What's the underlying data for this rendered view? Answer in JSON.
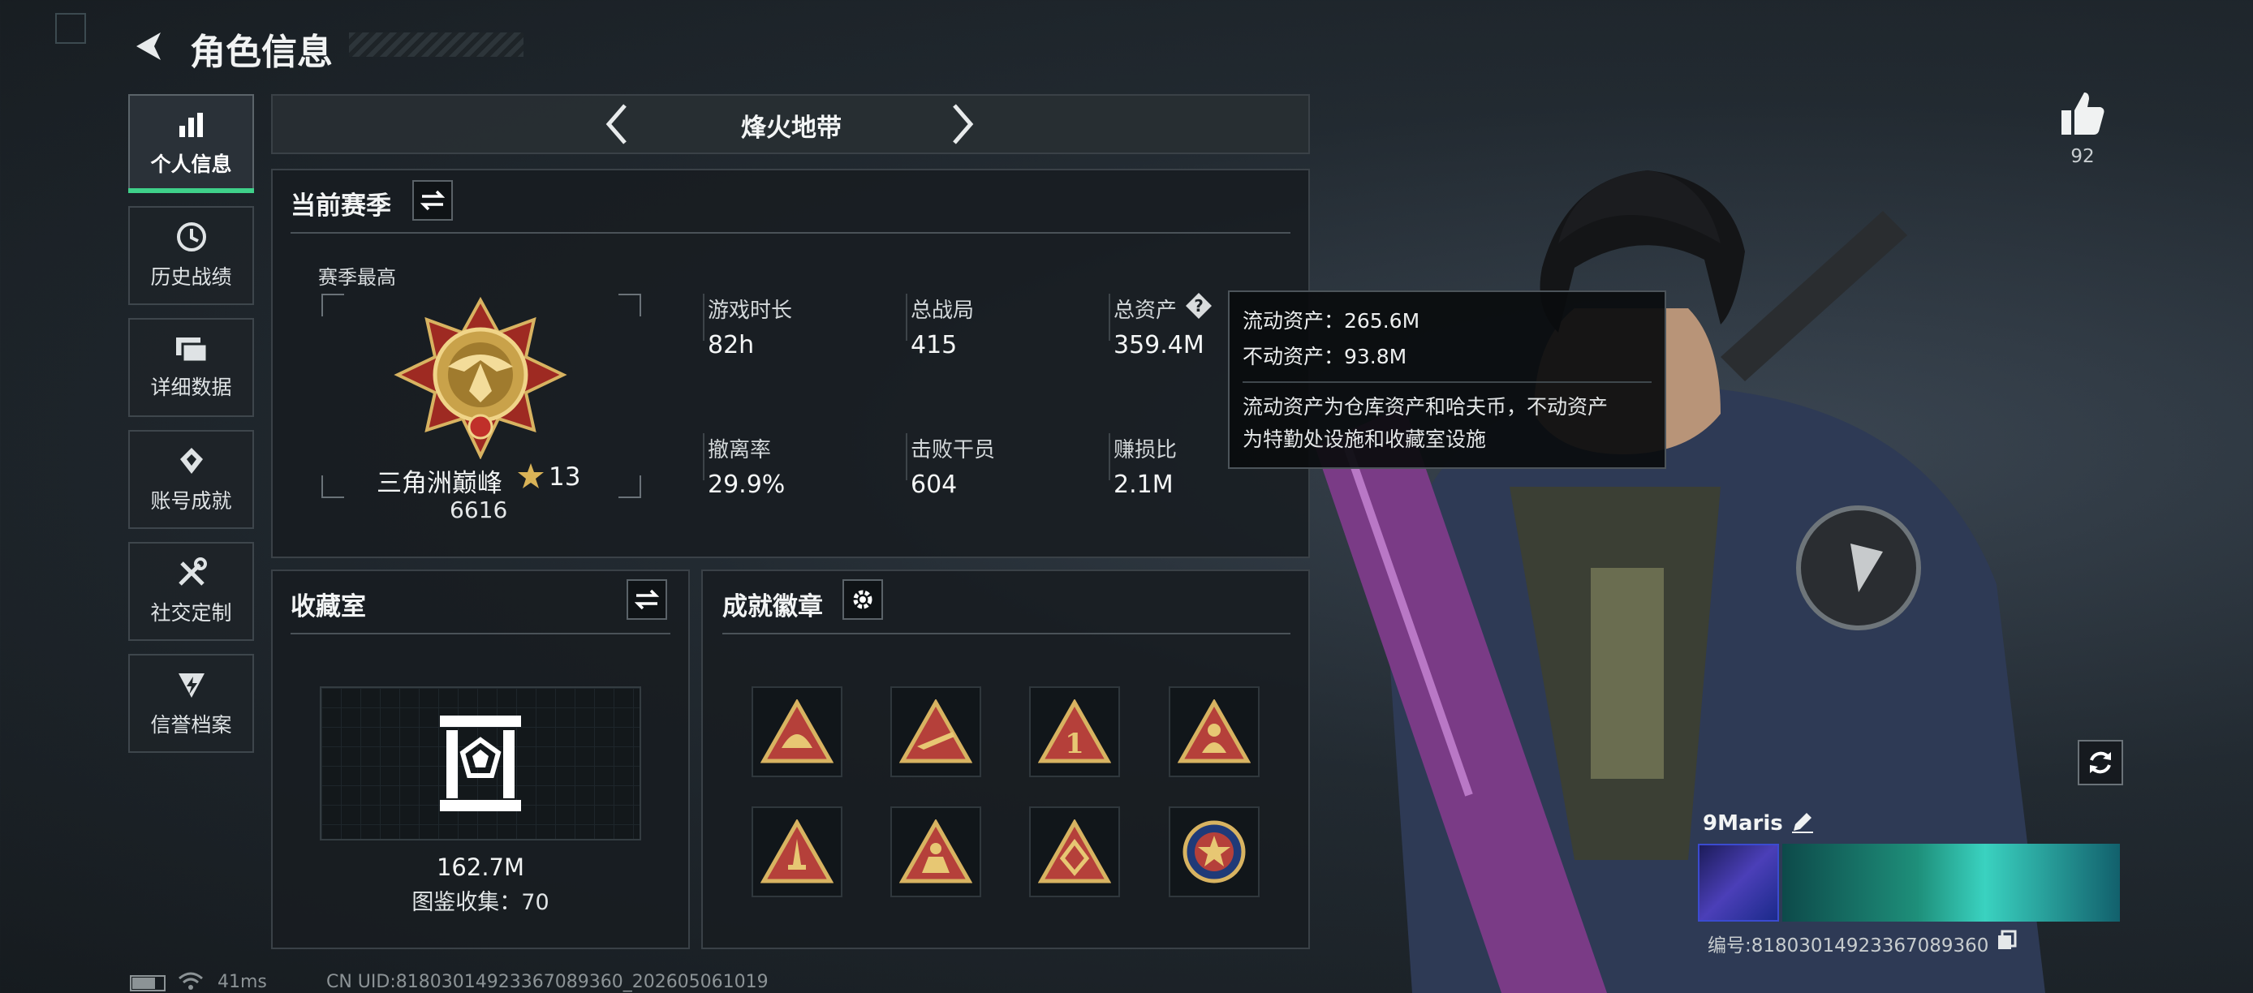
{
  "header": {
    "title": "角色信息"
  },
  "sidebar": {
    "items": [
      {
        "label": "个人信息",
        "active": true
      },
      {
        "label": "历史战绩"
      },
      {
        "label": "详细数据"
      },
      {
        "label": "账号成就"
      },
      {
        "label": "社交定制"
      },
      {
        "label": "信誉档案"
      }
    ]
  },
  "mode_selector": {
    "label": "烽火地带"
  },
  "season": {
    "title": "当前赛季",
    "best_label": "赛季最高",
    "rank_name": "三角洲巅峰",
    "rank_stars": "13",
    "rank_score": "6616",
    "stats": [
      {
        "label": "游戏时长",
        "value": "82h"
      },
      {
        "label": "总战局",
        "value": "415"
      },
      {
        "label": "总资产",
        "value": "359.4M"
      },
      {
        "label": "撤离率",
        "value": "29.9%"
      },
      {
        "label": "击败干员",
        "value": "604"
      },
      {
        "label": "赚损比",
        "value": "2.1M"
      }
    ]
  },
  "tooltip": {
    "liquid": "流动资产：265.6M",
    "fixed": "不动资产：93.8M",
    "desc_line1": "流动资产为仓库资产和哈夫币，不动资产",
    "desc_line2": "为特勤处设施和收藏室设施"
  },
  "collection": {
    "title": "收藏室",
    "value": "162.7M",
    "count_text": "图鉴收集：70"
  },
  "achievements": {
    "title": "成就徽章",
    "badges": [
      "badge-helmet",
      "badge-rifle",
      "badge-number-one",
      "badge-figure",
      "badge-dagger",
      "badge-soldier",
      "badge-emblem",
      "badge-star-medal"
    ]
  },
  "profile": {
    "likes": "92",
    "player_name": "9Maris",
    "id_text": "编号:8180301492336708936​0"
  },
  "status_bar": {
    "ping": "41ms",
    "uid": "CN UID:818030149233670893​60_202605061019"
  },
  "colors": {
    "accent_gold": "#c9a24a",
    "active_underline": "#3fd18a",
    "panel_bg": "#181d21"
  }
}
